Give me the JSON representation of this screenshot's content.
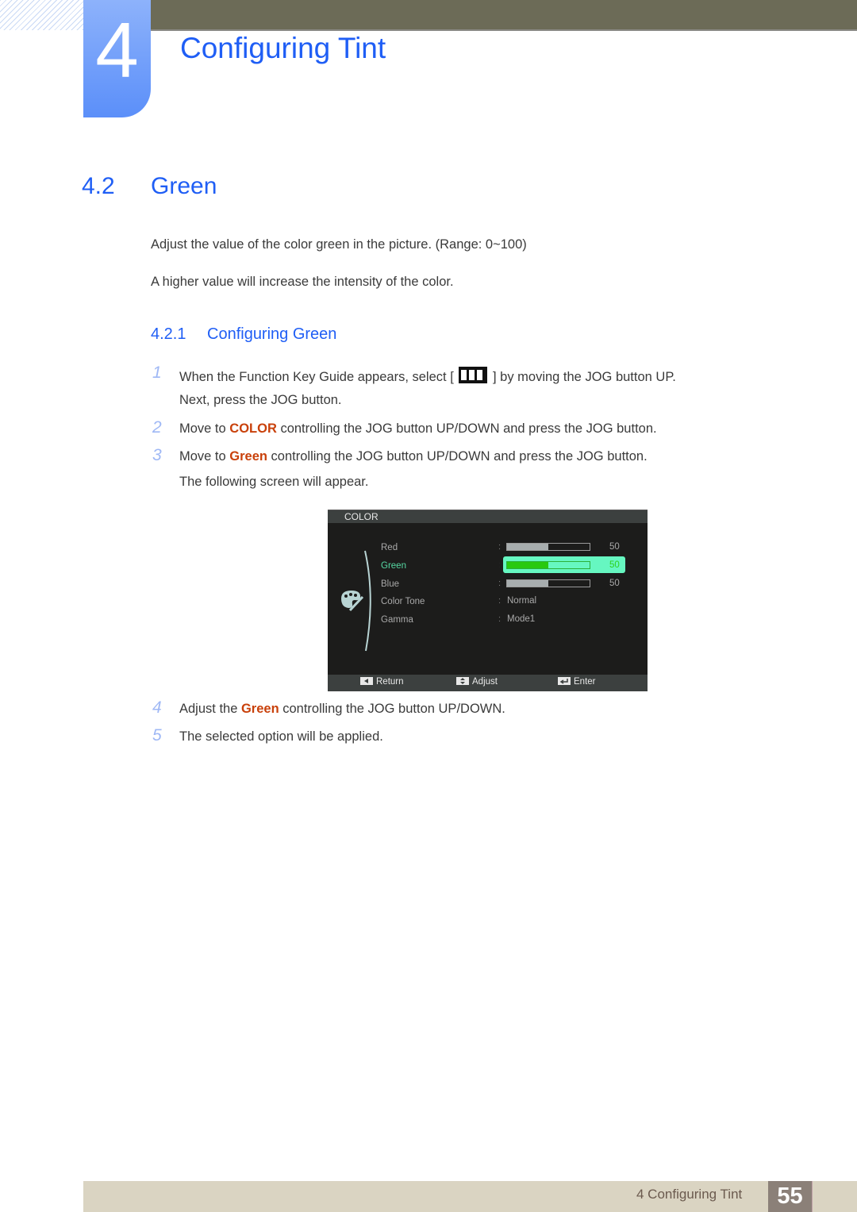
{
  "header": {
    "chapter_number": "4",
    "chapter_title": "Configuring Tint"
  },
  "section": {
    "number": "4.2",
    "title": "Green",
    "paragraphs": [
      "Adjust the value of the color green in the picture. (Range: 0~100)",
      "A higher value will increase the intensity of the color."
    ]
  },
  "subsection": {
    "number": "4.2.1",
    "title": "Configuring Green"
  },
  "steps": [
    {
      "num": "1",
      "pre": "When the Function Key Guide appears, select [",
      "icon": "menu-key-icon",
      "post": "] by moving the JOG button UP.",
      "line2": "Next, press the JOG button."
    },
    {
      "num": "2",
      "pre": "Move to ",
      "highlight": "COLOR",
      "post": " controlling the JOG button UP/DOWN and press the JOG button."
    },
    {
      "num": "3",
      "pre": "Move to ",
      "highlight": "Green",
      "post": " controlling the JOG button UP/DOWN and press the JOG button.",
      "line2": "The following screen will appear."
    },
    {
      "num": "4",
      "pre": "Adjust the ",
      "highlight": "Green",
      "post": " controlling the JOG button UP/DOWN."
    },
    {
      "num": "5",
      "pre": "The selected option will be applied."
    }
  ],
  "osd": {
    "title": "COLOR",
    "items": [
      {
        "label": "Red",
        "type": "slider",
        "value": 50,
        "max": 100,
        "selected": false
      },
      {
        "label": "Green",
        "type": "slider",
        "value": 50,
        "max": 100,
        "selected": true
      },
      {
        "label": "Blue",
        "type": "slider",
        "value": 50,
        "max": 100,
        "selected": false
      },
      {
        "label": "Color Tone",
        "type": "option",
        "value": "Normal"
      },
      {
        "label": "Gamma",
        "type": "option",
        "value": "Mode1"
      }
    ],
    "colon": ":",
    "footer": [
      {
        "icon": "left-arrow-icon",
        "label": "Return"
      },
      {
        "icon": "up-down-icon",
        "label": "Adjust"
      },
      {
        "icon": "enter-icon",
        "label": "Enter"
      }
    ]
  },
  "footer": {
    "chapter_ref": "4 Configuring Tint",
    "page_number": "55"
  },
  "colors": {
    "heading_blue": "#1f5ef5",
    "highlight_orange": "#c9410b",
    "osd_selected": "#66f7c1",
    "osd_fill_green": "#28c90f"
  }
}
